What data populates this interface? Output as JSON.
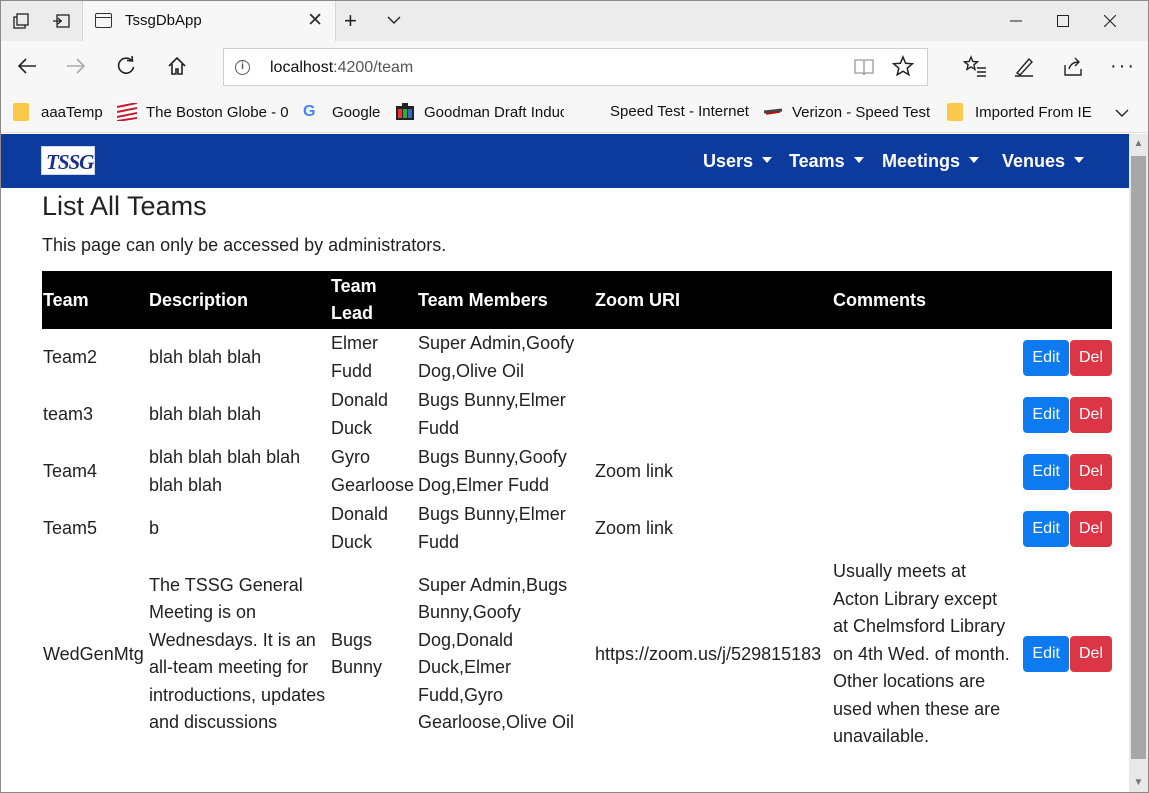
{
  "browser": {
    "tab_title": "TssgDbApp",
    "url_host": "localhost",
    "url_path": ":4200/team",
    "favorites": [
      {
        "label": "aaaTemp",
        "icon": "folder-icon"
      },
      {
        "label": "The Boston Globe - 0",
        "icon": "boston-globe-icon"
      },
      {
        "label": "Google",
        "icon": "google-icon"
      },
      {
        "label": "Goodman Draft Induc",
        "icon": "goodman-icon"
      },
      {
        "label": "Speed Test - Internet",
        "icon": ""
      },
      {
        "label": "Verizon - Speed Test",
        "icon": "verizon-icon"
      },
      {
        "label": "Imported From IE",
        "icon": "folder-icon"
      }
    ]
  },
  "app": {
    "logo_text": "TSSG",
    "menu": [
      "Users",
      "Teams",
      "Meetings",
      "Venues"
    ]
  },
  "page": {
    "title": "List All Teams",
    "note": "This page can only be accessed by administrators."
  },
  "table": {
    "headers": [
      "Team",
      "Description",
      "Team Lead",
      "Team Members",
      "Zoom URI",
      "Comments",
      ""
    ],
    "edit_label": "Edit",
    "delete_label": "Del",
    "rows": [
      {
        "team": "Team2",
        "description": "blah blah blah",
        "lead": "Elmer Fudd",
        "members": "Super Admin,Goofy Dog,Olive Oil",
        "zoom": "",
        "comments": ""
      },
      {
        "team": "team3",
        "description": "blah blah blah",
        "lead": "Donald Duck",
        "members": "Bugs Bunny,Elmer Fudd",
        "zoom": "",
        "comments": ""
      },
      {
        "team": "Team4",
        "description": "blah blah blah blah blah blah",
        "lead": "Gyro Gearloose",
        "members": "Bugs Bunny,Goofy Dog,Elmer Fudd",
        "zoom": "Zoom link",
        "comments": ""
      },
      {
        "team": "Team5",
        "description": "b",
        "lead": "Donald Duck",
        "members": "Bugs Bunny,Elmer Fudd",
        "zoom": "Zoom link",
        "comments": ""
      },
      {
        "team": "WedGenMtg",
        "description": "The TSSG General Meeting is on Wednesdays. It is an all-team meeting for introductions, updates and discussions",
        "lead": "Bugs Bunny",
        "members": "Super Admin,Bugs Bunny,Goofy Dog,Donald Duck,Elmer Fudd,Gyro Gearloose,Olive Oil",
        "zoom": "https://zoom.us/j/529815183",
        "comments": "Usually meets at Acton Library except at Chelmsford Library on 4th Wed. of month. Other locations are used when these are unavailable."
      }
    ]
  }
}
